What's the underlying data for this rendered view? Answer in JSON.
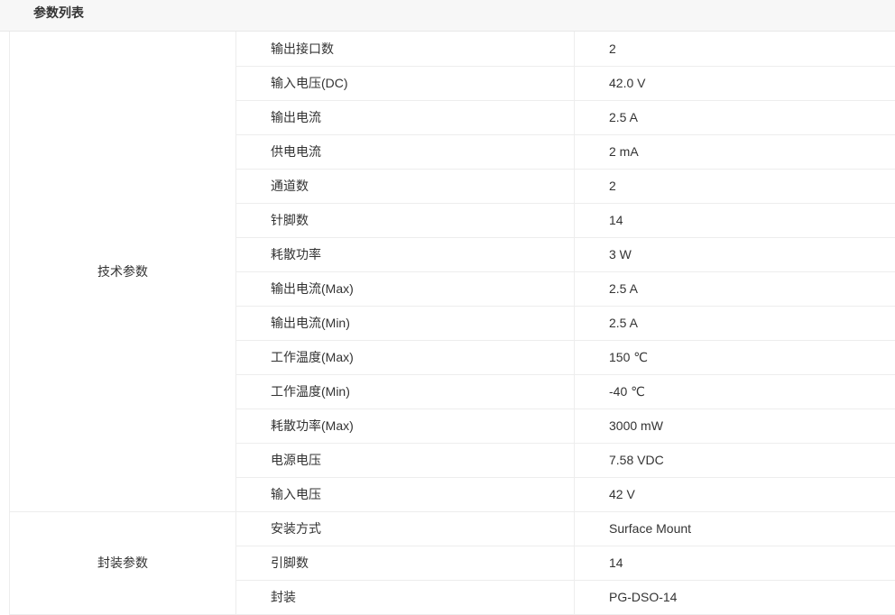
{
  "header": {
    "title": "参数列表"
  },
  "groups": [
    {
      "label": "技术参数",
      "rows": [
        {
          "name": "输出接口数",
          "value": "2"
        },
        {
          "name": "输入电压(DC)",
          "value": "42.0 V"
        },
        {
          "name": "输出电流",
          "value": "2.5 A"
        },
        {
          "name": "供电电流",
          "value": "2 mA"
        },
        {
          "name": "通道数",
          "value": "2"
        },
        {
          "name": "针脚数",
          "value": "14"
        },
        {
          "name": "耗散功率",
          "value": "3 W"
        },
        {
          "name": "输出电流(Max)",
          "value": "2.5 A"
        },
        {
          "name": "输出电流(Min)",
          "value": "2.5 A"
        },
        {
          "name": "工作温度(Max)",
          "value": "150 ℃"
        },
        {
          "name": "工作温度(Min)",
          "value": "-40 ℃"
        },
        {
          "name": "耗散功率(Max)",
          "value": "3000 mW"
        },
        {
          "name": "电源电压",
          "value": "7.58 VDC"
        },
        {
          "name": "输入电压",
          "value": "42 V"
        }
      ]
    },
    {
      "label": "封装参数",
      "rows": [
        {
          "name": "安装方式",
          "value": "Surface Mount"
        },
        {
          "name": "引脚数",
          "value": "14"
        },
        {
          "name": "封装",
          "value": "PG-DSO-14"
        }
      ]
    }
  ]
}
